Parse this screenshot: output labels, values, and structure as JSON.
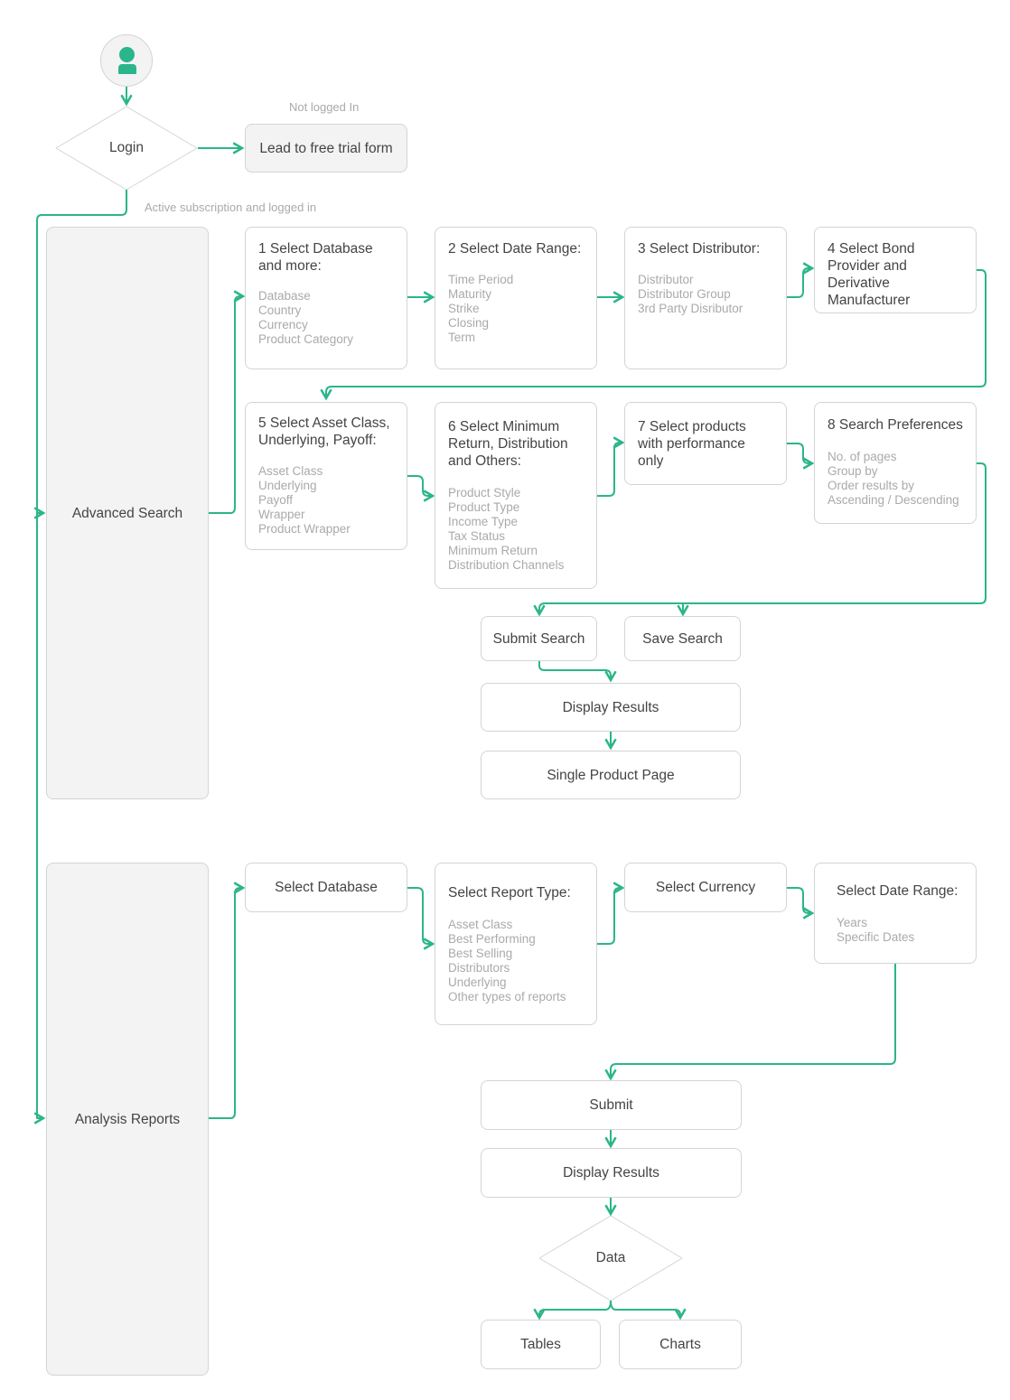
{
  "colors": {
    "accent": "#2bb58a",
    "border": "#d4d4d4",
    "muted_text": "#aaaaaa",
    "text": "#444444",
    "panel_bg": "#f3f3f3"
  },
  "start": {
    "icon": "user-icon"
  },
  "login": {
    "label": "Login",
    "not_logged_in_label": "Not logged In",
    "lead_form": "Lead to free trial form",
    "logged_in_label": "Active subscription and logged in"
  },
  "advanced_search": {
    "label": "Advanced Search",
    "steps": [
      {
        "title": "1 Select Database\nand more:",
        "items": [
          "Database",
          "Country",
          "Currency",
          "Product Category"
        ]
      },
      {
        "title": "2 Select Date Range:",
        "items": [
          "Time Period",
          "Maturity",
          "Strike",
          "Closing",
          "Term"
        ]
      },
      {
        "title": "3 Select Distributor:",
        "items": [
          "Distributor",
          "Distributor Group",
          "3rd Party Disributor"
        ]
      },
      {
        "title": "4 Select Bond\nProvider and Derivative\nManufacturer",
        "items": []
      },
      {
        "title": "5 Select Asset Class,\nUnderlying, Payoff:",
        "items": [
          "Asset Class",
          "Underlying",
          "Payoff",
          "Wrapper",
          "Product Wrapper"
        ]
      },
      {
        "title": "6 Select Minimum\nReturn, Distribution\nand Others:",
        "items": [
          "Product Style",
          "Product Type",
          "Income Type",
          "Tax Status",
          "Minimum Return",
          "Distribution Channels"
        ]
      },
      {
        "title": "7 Select products\nwith performance\nonly",
        "items": []
      },
      {
        "title": "8 Search Preferences",
        "items": [
          "No. of pages",
          "Group by",
          "Order results by",
          "Ascending / Descending"
        ]
      }
    ],
    "submit_search": "Submit Search",
    "save_search": "Save Search",
    "display_results": "Display Results",
    "single_product_page": "Single Product Page"
  },
  "analysis_reports": {
    "label": "Analysis Reports",
    "select_database": "Select Database",
    "report_type": {
      "title": "Select Report Type:",
      "items": [
        "Asset Class",
        "Best Performing",
        "Best Selling",
        "Distributors",
        "Underlying",
        "Other types of reports"
      ]
    },
    "select_currency": "Select Currency",
    "date_range": {
      "title": "Select Date Range:",
      "items": [
        "Years",
        "Specific Dates"
      ]
    },
    "submit": "Submit",
    "display_results": "Display Results",
    "data_decision": "Data",
    "tables": "Tables",
    "charts": "Charts"
  }
}
